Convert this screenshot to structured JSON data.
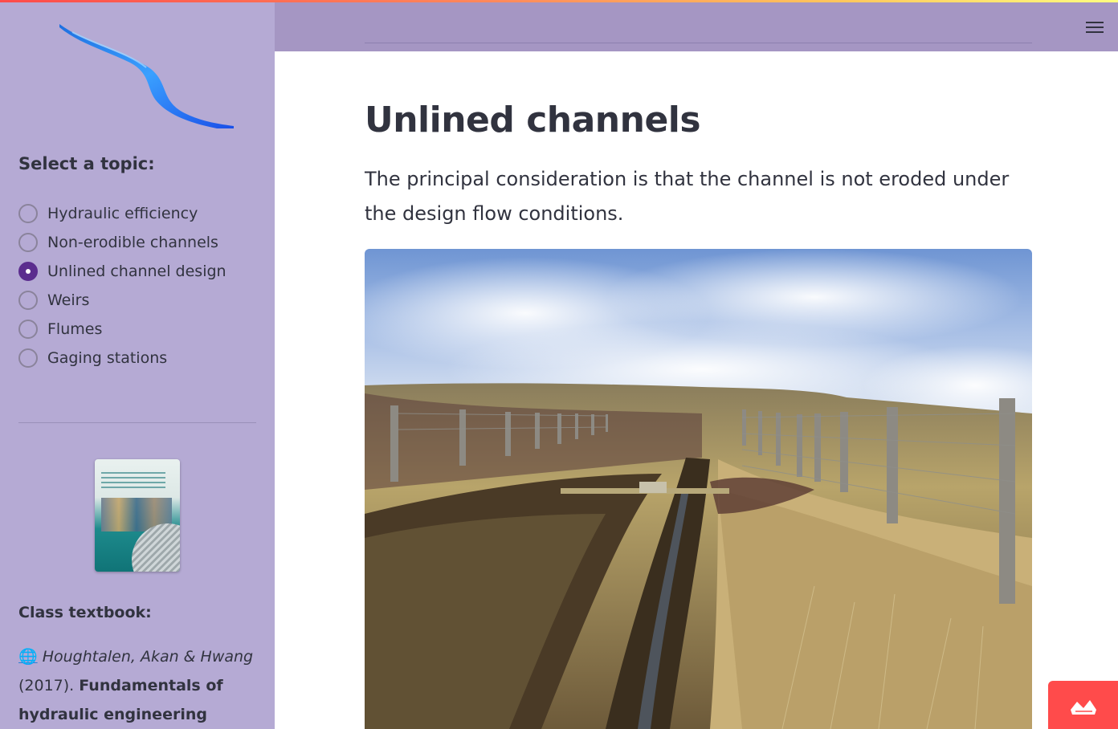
{
  "sidebar": {
    "topic_heading": "Select a topic:",
    "topics": [
      {
        "label": "Hydraulic efficiency",
        "selected": false
      },
      {
        "label": "Non-erodible channels",
        "selected": false
      },
      {
        "label": "Unlined channel design",
        "selected": true
      },
      {
        "label": "Weirs",
        "selected": false
      },
      {
        "label": "Flumes",
        "selected": false
      },
      {
        "label": "Gaging stations",
        "selected": false
      }
    ],
    "textbook_label": "Class textbook:",
    "citation": {
      "globe": "🌐",
      "authors": "Houghtalen, Akan & Hwang",
      "year": "(2017).",
      "title": "Fundamentals of hydraulic engineering systems"
    }
  },
  "main": {
    "title": "Unlined channels",
    "text": "The principal consideration is that the channel is not eroded under the design flow conditions."
  },
  "colors": {
    "sidebar_bg": "#b5aad4",
    "header_bg": "#a596c3",
    "accent": "#5b2d8e",
    "badge": "#ff4b4b"
  },
  "icons": {
    "menu": "hamburger-menu-icon",
    "logo": "river-channel-logo",
    "badge": "streamlit-crown-icon"
  }
}
